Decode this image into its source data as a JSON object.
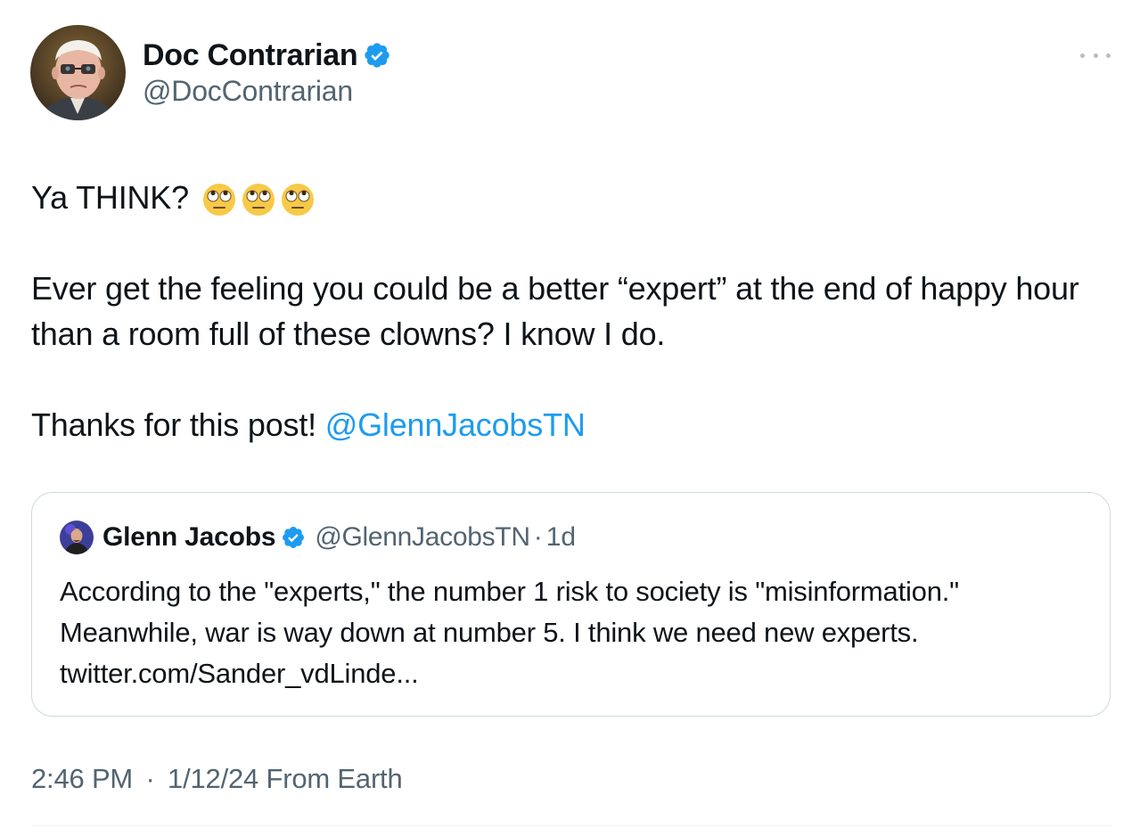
{
  "author": {
    "display_name": "Doc Contrarian",
    "handle": "@DocContrarian",
    "avatar_icon": "profile-photo-icon",
    "verified_icon": "verified-badge-icon"
  },
  "more_icon": "more-options-icon",
  "tweet": {
    "line1_text": "Ya THINK?",
    "line1_emoji": [
      "face-with-rolling-eyes",
      "face-with-rolling-eyes",
      "face-with-rolling-eyes"
    ],
    "line2": "Ever get the feeling you could be a better “expert” at the end of happy hour than a room full of these clowns? I know I do.",
    "line3_text": "Thanks for this post!",
    "line3_mention": "@GlennJacobsTN"
  },
  "quote": {
    "display_name": "Glenn Jacobs",
    "handle": "@GlennJacobsTN",
    "separator": "·",
    "time": "1d",
    "line1": "According to the \"experts,\" the number 1 risk to society is \"misinformation.\"",
    "line2": "Meanwhile, war is way down at number 5. I think we need new experts.",
    "link": "twitter.com/Sander_vdLinde..."
  },
  "meta": {
    "time": "2:46 PM",
    "separator": "·",
    "date": "1/12/24",
    "source": "From Earth"
  },
  "colors": {
    "link": "#1d9bf0",
    "secondary_text": "#536471",
    "border": "#cfd9de",
    "verified": "#1d9bf0"
  }
}
